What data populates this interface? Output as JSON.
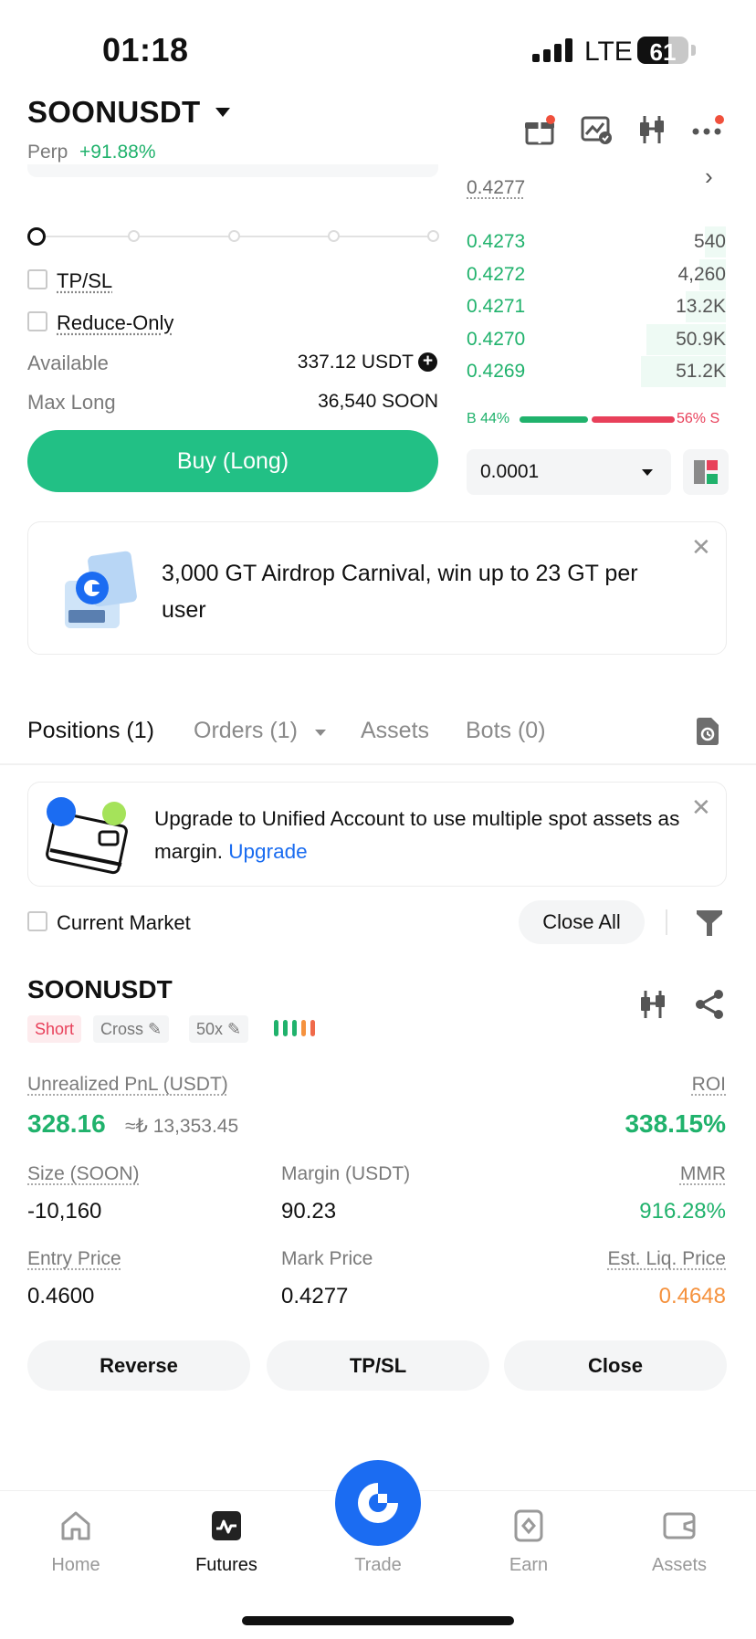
{
  "status_bar": {
    "time": "01:18",
    "network": "LTE",
    "battery": "61",
    "battery_level_pct": 61
  },
  "header": {
    "pair": "SOONUSDT",
    "market_type": "Perp",
    "change": "+91.88%"
  },
  "order_form": {
    "tpsl_label": "TP/SL",
    "reduce_only_label": "Reduce-Only",
    "available_label": "Available",
    "available_value": "337.12 USDT",
    "max_long_label": "Max Long",
    "max_long_value": "36,540 SOON",
    "buy_label": "Buy (Long)"
  },
  "order_book": {
    "top_price": "0.4277",
    "rows": [
      {
        "price": "0.4273",
        "qty": "540",
        "depth": 0.08
      },
      {
        "price": "0.4272",
        "qty": "4,260",
        "depth": 0.1
      },
      {
        "price": "0.4271",
        "qty": "13.2K",
        "depth": 0.15
      },
      {
        "price": "0.4270",
        "qty": "50.9K",
        "depth": 0.3
      },
      {
        "price": "0.4269",
        "qty": "51.2K",
        "depth": 0.32
      }
    ],
    "buy_ratio": "B 44%",
    "sell_ratio": "56% S",
    "buy_pct": 44,
    "precision": "0.0001"
  },
  "promo": {
    "text": "3,000 GT Airdrop Carnival, win up to 23 GT per user"
  },
  "tabs": [
    {
      "label": "Positions (1)",
      "active": true
    },
    {
      "label": "Orders (1)",
      "active": false
    },
    {
      "label": "Assets",
      "active": false
    },
    {
      "label": "Bots (0)",
      "active": false
    }
  ],
  "upgrade_banner": {
    "text": "Upgrade to Unified Account to use multiple spot assets as margin.",
    "link": "Upgrade"
  },
  "filters": {
    "current_market": "Current Market",
    "close_all": "Close All"
  },
  "position": {
    "symbol": "SOONUSDT",
    "side": "Short",
    "margin_mode": "Cross",
    "leverage": "50x",
    "unrealized_pnl_label": "Unrealized PnL (USDT)",
    "unrealized_pnl": "328.16",
    "unrealized_pnl_fiat": "≈₺ 13,353.45",
    "roi_label": "ROI",
    "roi": "338.15%",
    "size_label": "Size (SOON)",
    "size": "-10,160",
    "margin_label": "Margin (USDT)",
    "margin": "90.23",
    "mmr_label": "MMR",
    "mmr": "916.28%",
    "entry_label": "Entry Price",
    "entry": "0.4600",
    "mark_label": "Mark Price",
    "mark": "0.4277",
    "liq_label": "Est. Liq. Price",
    "liq": "0.4648",
    "actions": {
      "reverse": "Reverse",
      "tpsl": "TP/SL",
      "close": "Close"
    }
  },
  "nav": [
    {
      "label": "Home",
      "icon": "home-icon",
      "active": false
    },
    {
      "label": "Futures",
      "icon": "futures-icon",
      "active": true
    },
    {
      "label": "Trade",
      "icon": "trade-icon",
      "active": false
    },
    {
      "label": "Earn",
      "icon": "earn-icon",
      "active": false
    },
    {
      "label": "Assets",
      "icon": "assets-icon",
      "active": false
    }
  ],
  "colors": {
    "green": "#20b26c",
    "red": "#e8405a",
    "orange": "#f5923e",
    "blue": "#1b6cf2"
  }
}
